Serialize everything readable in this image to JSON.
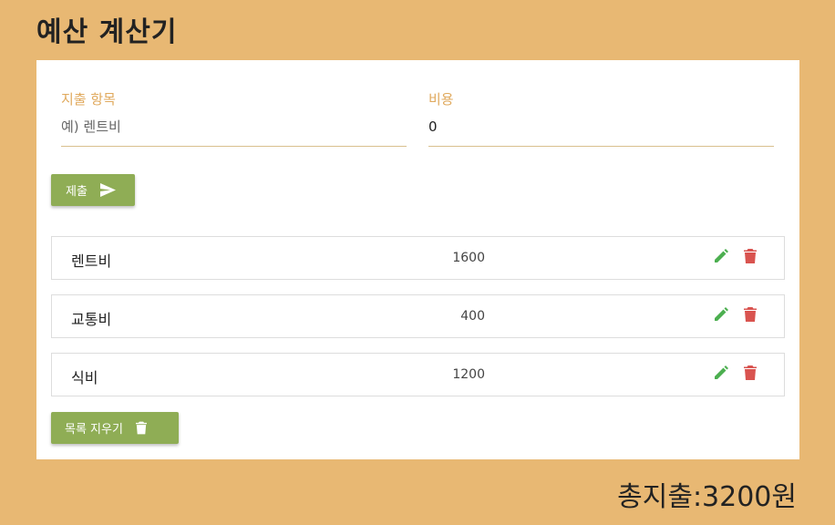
{
  "header": {
    "title": "예산 계산기"
  },
  "form": {
    "expense_label": "지출 항목",
    "expense_placeholder": "예) 렌트비",
    "expense_value": "",
    "cost_label": "비용",
    "cost_value": "0",
    "submit_label": "제출",
    "submit_icon": "send-icon"
  },
  "items": [
    {
      "name": "렌트비",
      "amount": "1600"
    },
    {
      "name": "교통비",
      "amount": "400"
    },
    {
      "name": "식비",
      "amount": "1200"
    }
  ],
  "item_icons": {
    "edit": "pencil-icon",
    "delete": "trash-icon"
  },
  "clear_button": {
    "label": "목록 지우기",
    "icon": "trash-icon"
  },
  "total": {
    "text": "총지출:3200원"
  },
  "colors": {
    "background": "#e8b873",
    "label": "#e0a95d",
    "button": "#8fad55",
    "edit": "#4caf50",
    "delete": "#d9534f"
  }
}
